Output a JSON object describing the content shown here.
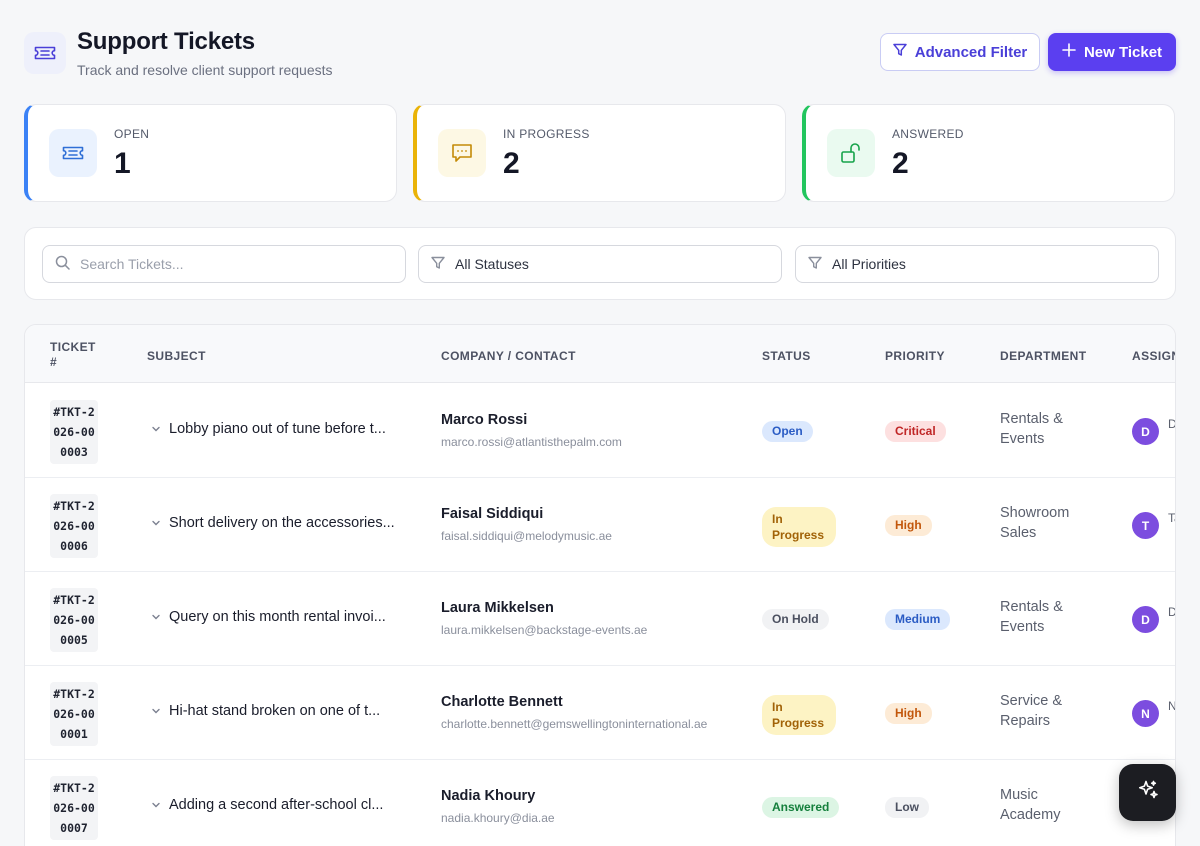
{
  "header": {
    "title": "Support Tickets",
    "subtitle": "Track and resolve client support requests",
    "advanced_filter_label": "Advanced Filter",
    "new_ticket_label": "New Ticket"
  },
  "stats": [
    {
      "label": "OPEN",
      "value": "1",
      "icon": "ticket-icon",
      "accent": "#3b82f6"
    },
    {
      "label": "IN PROGRESS",
      "value": "2",
      "icon": "chat-icon",
      "accent": "#eab308"
    },
    {
      "label": "ANSWERED",
      "value": "2",
      "icon": "unlock-icon",
      "accent": "#22c55e"
    }
  ],
  "filters": {
    "search_placeholder": "Search Tickets...",
    "status_value": "All Statuses",
    "priority_value": "All Priorities"
  },
  "table": {
    "columns": {
      "ticket": "TICKET #",
      "subject": "SUBJECT",
      "company": "COMPANY / CONTACT",
      "status": "STATUS",
      "priority": "PRIORITY",
      "department": "DEPARTMENT",
      "assignee": "ASSIGN"
    },
    "rows": [
      {
        "id": "#TKT-2026-000003",
        "subject": "Lobby piano out of tune before t...",
        "contact_name": "Marco Rossi",
        "contact_email": "marco.rossi@atlantisthepalm.com",
        "status": "Open",
        "priority": "Critical",
        "department": "Rentals & Events",
        "assignee_initial": "D",
        "assignee_clip": "D C"
      },
      {
        "id": "#TKT-2026-000006",
        "subject": "Short delivery on the accessories...",
        "contact_name": "Faisal Siddiqui",
        "contact_email": "faisal.siddiqui@melodymusic.ae",
        "status": "In Progress",
        "priority": "High",
        "department": "Showroom Sales",
        "assignee_initial": "T",
        "assignee_clip": "Ta B"
      },
      {
        "id": "#TKT-2026-000005",
        "subject": "Query on this month rental invoi...",
        "contact_name": "Laura Mikkelsen",
        "contact_email": "laura.mikkelsen@backstage-events.ae",
        "status": "On Hold",
        "priority": "Medium",
        "department": "Rentals & Events",
        "assignee_initial": "D",
        "assignee_clip": "D C"
      },
      {
        "id": "#TKT-2026-000001",
        "subject": "Hi-hat stand broken on one of t...",
        "contact_name": "Charlotte Bennett",
        "contact_email": "charlotte.bennett@gemswellingtoninternational.ae",
        "status": "In Progress",
        "priority": "High",
        "department": "Service & Repairs",
        "assignee_initial": "N",
        "assignee_clip": "N Iv"
      },
      {
        "id": "#TKT-2026-000007",
        "subject": "Adding a second after-school cl...",
        "contact_name": "Nadia Khoury",
        "contact_email": "nadia.khoury@dia.ae",
        "status": "Answered",
        "priority": "Low",
        "department": "Music Academy",
        "assignee_initial": "",
        "assignee_clip": ""
      }
    ]
  },
  "colors": {
    "primary": "#5b3ff0",
    "status_open_bg": "#dbe8fd",
    "status_open_fg": "#2b5cc4",
    "status_progress_bg": "#fdf3c4",
    "status_progress_fg": "#a16207",
    "status_hold_bg": "#f1f2f4",
    "status_hold_fg": "#4b5060",
    "status_answered_bg": "#dcf5e4",
    "status_answered_fg": "#15803d",
    "priority_critical_bg": "#fde0e0",
    "priority_critical_fg": "#c02626",
    "priority_high_bg": "#fdebd6",
    "priority_high_fg": "#c2570c",
    "priority_medium_bg": "#dbe8fd",
    "priority_medium_fg": "#2b5cc4",
    "priority_low_bg": "#f1f2f4",
    "priority_low_fg": "#4b5060"
  },
  "fab": {
    "icon": "sparkles-icon"
  }
}
